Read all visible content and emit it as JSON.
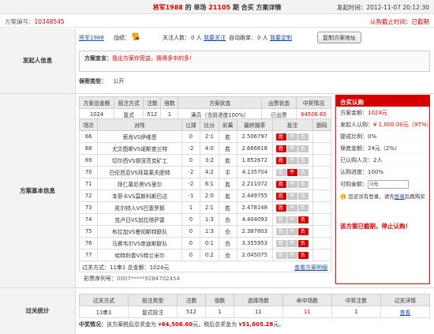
{
  "title": {
    "user": "将军1988",
    "center_mid": " 的 单场 ",
    "issue": "21105",
    "center_end": " 期 合买 方案详情",
    "publish_label": "发起时间：",
    "publish_time": "2012-11-07 20:12:30"
  },
  "id_bar": {
    "label": "方案编号：",
    "value": "10348545",
    "deadline": "认购截止时间：已截期"
  },
  "initiator": {
    "section_label": "发起人信息",
    "user": "将军1988",
    "record_label": "战绩：",
    "follow_label": "关注人数：",
    "follow_count": "0 人",
    "follow_link": "我要关注",
    "auto_label": "自动跟单：",
    "auto_count": "0 人",
    "auto_link": "我要定制",
    "copy_btn": "复制方案地址",
    "declaration_label": "方案宣言：",
    "declaration_text": "我出方案你受益，猜得多中的多！",
    "privacy_label": "保密类型：",
    "privacy_value": "公开"
  },
  "plan": {
    "section_label": "方案基本信息",
    "summary_headers": [
      "方案总金额",
      "投注方式",
      "注数",
      "倍数",
      "方案状态",
      "出票状态",
      "中奖情况"
    ],
    "summary_row": [
      "1024",
      "复式",
      "512",
      "1",
      "满员（当前进度100%）",
      "已出票",
      "64506.60"
    ],
    "match_headers": [
      "场次",
      "对阵",
      "让球",
      "比分",
      "彩果",
      "最终赔率",
      "投注",
      "胆码"
    ],
    "matches": [
      [
        "66",
        "索肖VS伊维恩",
        "0",
        "2:1",
        "胜",
        "2.506797",
        "胜",
        "平",
        "负"
      ],
      [
        "68",
        "尤文图斯VS诺斯查兰特",
        "-2",
        "4:0",
        "胜",
        "2.666618",
        "胜",
        "平",
        "负"
      ],
      [
        "69",
        "切尔西VS顿涅茨克矿工",
        "0",
        "3:2",
        "胜",
        "1.852672",
        "胜",
        "平",
        "负"
      ],
      [
        "70",
        "巴伦西亚VS拜耳莱夫肥特",
        "-2",
        "4:2",
        "平",
        "4.135704",
        "胜",
        "平",
        "负"
      ],
      [
        "71",
        "拜仁慕尼黑VS里尔",
        "-2",
        "6:1",
        "胜",
        "2.211072",
        "胜",
        "平",
        "负"
      ],
      [
        "72",
        "本菲卡VS莫斯科斯巴达",
        "-1",
        "2:0",
        "胜",
        "2.449755",
        "胜",
        "平",
        "负"
      ],
      [
        "73",
        "凯尔特人VS巴塞罗那",
        "1",
        "2:1",
        "胜",
        "2.478148",
        "胜",
        "平",
        "负"
      ],
      [
        "74",
        "克卢日VS加拉塔萨雷",
        "0",
        "1:3",
        "负",
        "4.404093",
        "胜",
        "平",
        "负"
      ],
      [
        "75",
        "布拉加VS曼彻斯特联队",
        "0",
        "1:3",
        "负",
        "2.387803",
        "胜",
        "平",
        "负"
      ],
      [
        "76",
        "马赛韦尔VS帝迪斯联队",
        "0",
        "0:1",
        "负",
        "3.355953",
        "胜",
        "平",
        "负"
      ],
      [
        "77",
        "哈特利普VS特兰米尔",
        "0",
        "0:2",
        "负",
        "2.045075",
        "胜",
        "平",
        "负"
      ]
    ],
    "footer_text": "过关方式：11串1 总金额：1024元",
    "footer_link": "查看方案明细",
    "ticket_label": "彩票序列号：",
    "ticket_value": "0007*****9284702454"
  },
  "syndicate": {
    "header": "合买认购",
    "total_label": "方案金额：",
    "total_value": "1024元",
    "initiator_label": "发起人认购：",
    "initiator_value": "¥ 1,000.00元（97%）",
    "commission_label": "提成比例：",
    "commission_value": "0%",
    "guarantee_label": "保底金额：",
    "guarantee_value": "24元（2%）",
    "participants_label": "已认购人次：",
    "participants_value": "2人",
    "progress_label": "认购进度：",
    "progress_value": "100%",
    "buy_label": "可购金额：",
    "buy_value": "0元",
    "login_text": "您还没有登录，请先",
    "login_link": "登录",
    "login_end": "后再购买",
    "closed_text": "该方案已截期，停止认购！"
  },
  "stats": {
    "section_label": "过关统计",
    "headers": [
      "过关方式",
      "投注类型",
      "注数",
      "倍数",
      "选择场数",
      "命中场数",
      "中奖注数",
      "过关详情"
    ],
    "row": [
      "11串1",
      "复式投注",
      "512",
      "1",
      "11",
      "11",
      "1",
      "查看"
    ],
    "prize_label": "中奖情况：",
    "prize_pre": "该方案税后总奖金为 ¥",
    "prize_value": "64,506.60",
    "prize_mid": "元，税后总奖金为 ¥",
    "prize_value2": "51,605.28",
    "prize_end": "元。"
  },
  "colors": {
    "accent_red": "#d40000",
    "link_blue": "#1f4fa0",
    "header_gray": "#e9e9e9"
  }
}
